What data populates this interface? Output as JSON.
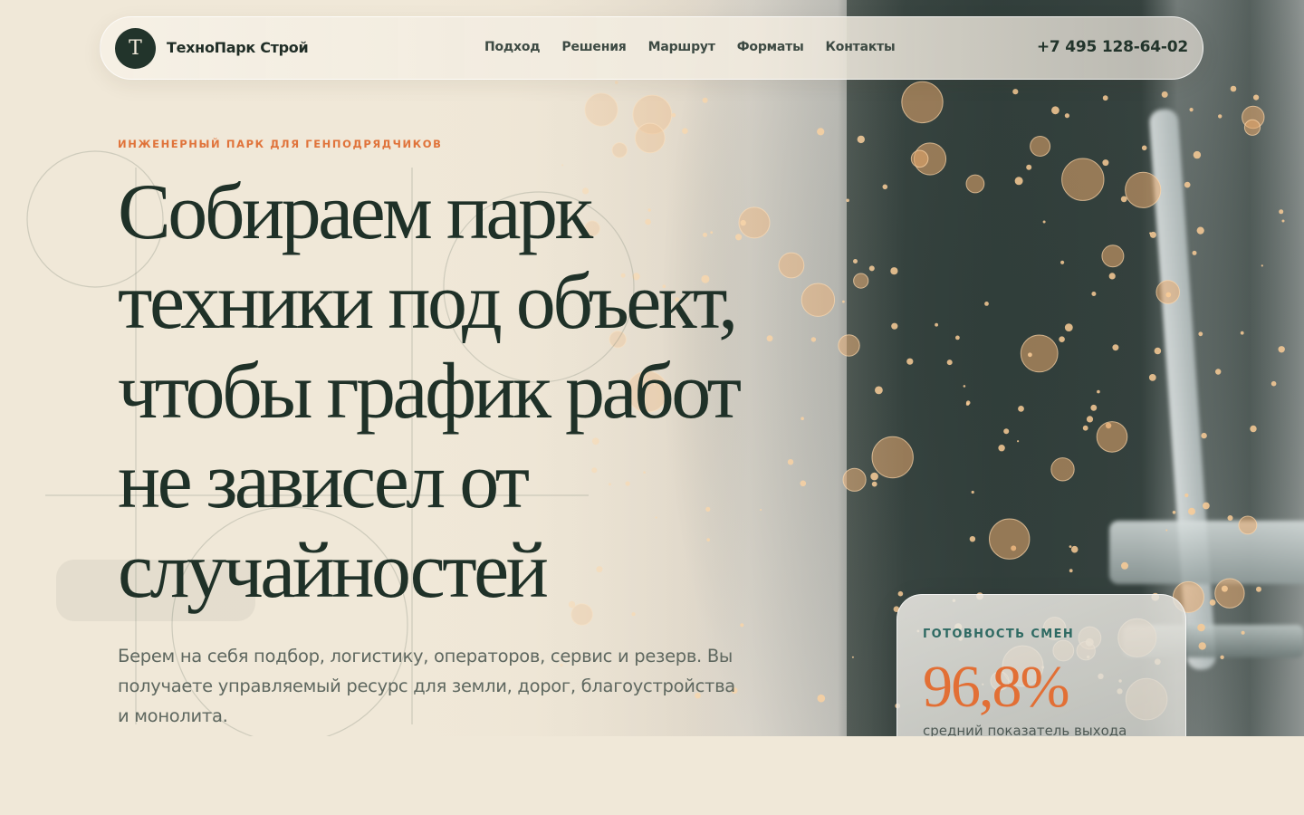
{
  "brand": {
    "mark": "Т",
    "name": "ТехноПарк Строй"
  },
  "nav": {
    "items": [
      {
        "label": "Подход"
      },
      {
        "label": "Решения"
      },
      {
        "label": "Маршрут"
      },
      {
        "label": "Форматы"
      },
      {
        "label": "Контакты"
      }
    ],
    "phone": "+7 495 128-64-02"
  },
  "hero": {
    "eyebrow": "ИНЖЕНЕРНЫЙ ПАРК ДЛЯ ГЕНПОДРЯДЧИКОВ",
    "headline": "Собираем парк техники под объект, чтобы график работ не зависел от случайностей",
    "lede": "Берем на себя подбор, логистику, операторов, сервис и резерв. Вы получаете управляемый ресурс для земли, дорог, благоустройства и монолита."
  },
  "stat": {
    "label": "ГОТОВНОСТЬ СМЕН",
    "value": "96,8%",
    "caption": "средний показатель выхода"
  },
  "colors": {
    "accent": "#e26f35",
    "brand_dark": "#22342b",
    "teal": "#2f6a63",
    "background": "#f0e8d8"
  }
}
